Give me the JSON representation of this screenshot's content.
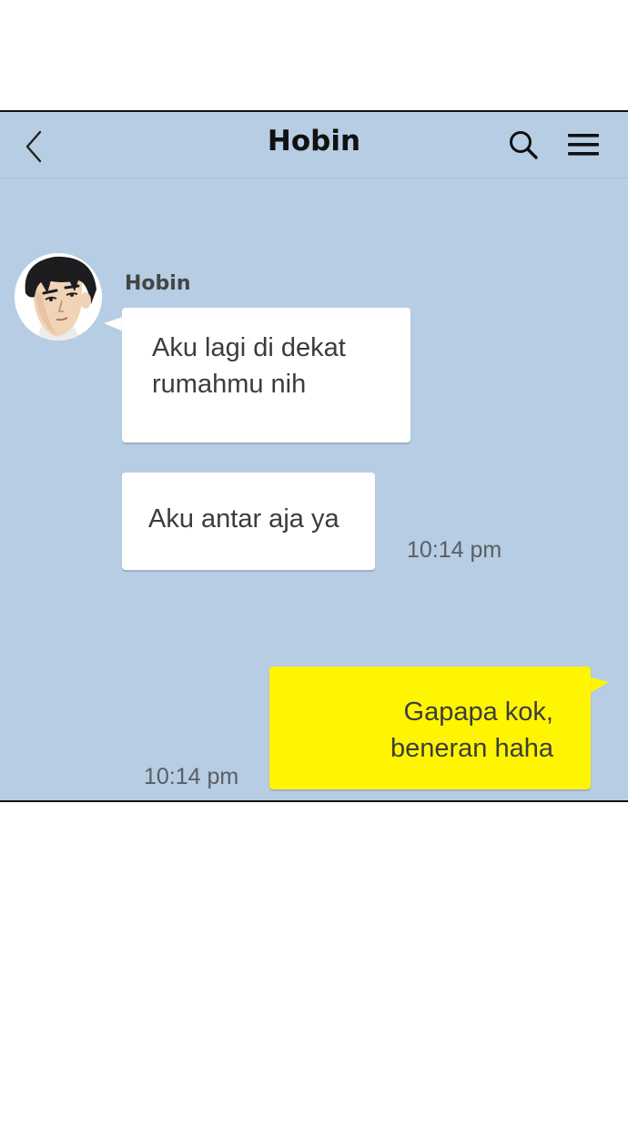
{
  "header": {
    "title": "Hobin",
    "back_icon": "chevron-left-icon",
    "search_icon": "search-icon",
    "menu_icon": "hamburger-menu-icon"
  },
  "colors": {
    "chat_background": "#b6cde3",
    "incoming_bubble": "#ffffff",
    "outgoing_bubble": "#fff500",
    "text": "#3c3c3c"
  },
  "messages": {
    "incoming": {
      "sender": "Hobin",
      "bubble1": [
        "Aku lagi di dekat",
        "rumahmu nih"
      ],
      "bubble2": "Aku antar aja ya",
      "time": "10:14 pm"
    },
    "outgoing": {
      "lines": [
        "Gapapa kok,",
        "beneran haha"
      ],
      "time": "10:14 pm"
    }
  }
}
